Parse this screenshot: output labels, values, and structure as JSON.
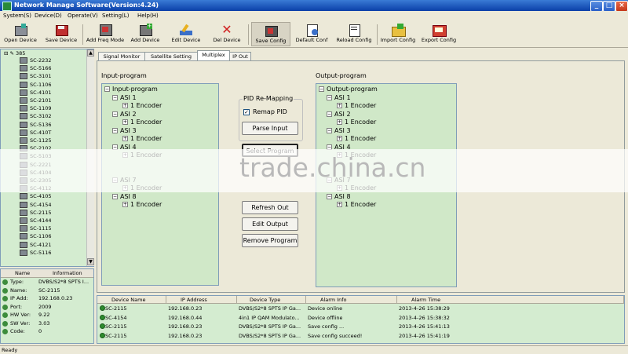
{
  "window": {
    "title": "Network Manage Software(Version:4.24)"
  },
  "menu": [
    "System(S)",
    "Device(D)",
    "Operate(V)",
    "Setting(L)",
    "Help(H)"
  ],
  "toolbar": [
    {
      "label": "Open Device",
      "icon": "open-device-icon"
    },
    {
      "label": "Save Device",
      "icon": "save-device-icon"
    },
    {
      "label": "Add Freq Mode",
      "icon": "add-freq-mode-icon"
    },
    {
      "label": "Add Device",
      "icon": "add-device-icon"
    },
    {
      "label": "Edit Device",
      "icon": "edit-device-icon"
    },
    {
      "label": "Del Device",
      "icon": "delete-device-icon"
    },
    {
      "label": "Save Config",
      "icon": "save-config-icon"
    },
    {
      "label": "Default Conf",
      "icon": "default-config-icon"
    },
    {
      "label": "Reload Config",
      "icon": "reload-config-icon"
    },
    {
      "label": "Import Config",
      "icon": "import-config-icon"
    },
    {
      "label": "Export Config",
      "icon": "export-config-icon"
    }
  ],
  "device_tree": {
    "root": "385",
    "items": [
      "SC-2232",
      "SC-5166",
      "SC-3101",
      "SC-1106",
      "SC-4101",
      "SC-2101",
      "SC-1109",
      "SC-3102",
      "SC-5136",
      "SC-410T",
      "SC-1125",
      "SC-2102",
      "SC-5103",
      "SC-2221",
      "SC-4104",
      "SC-2305",
      "SC-4112",
      "SC-4105",
      "SC-4154",
      "SC-2115",
      "SC-4144",
      "SC-1115",
      "SC-1106",
      "SC-4121",
      "SC-5116"
    ]
  },
  "info_panel": {
    "headers": [
      "Name",
      "Information"
    ],
    "rows": [
      {
        "key": "Type:",
        "value": "DVBS/S2*8 SPTS I..."
      },
      {
        "key": "Name:",
        "value": "SC-2115"
      },
      {
        "key": "IP Add:",
        "value": "192.168.0.23"
      },
      {
        "key": "Port:",
        "value": "2009"
      },
      {
        "key": "HW Ver:",
        "value": "9.22"
      },
      {
        "key": "SW Ver:",
        "value": "3.03"
      },
      {
        "key": "Code:",
        "value": "0"
      }
    ]
  },
  "tabs": [
    "Signal Monitor",
    "Satellite Setting",
    "Multiplex",
    "IP Out"
  ],
  "multiplex": {
    "input_label": "Input-program",
    "output_label": "Output-program",
    "input_tree": {
      "root": "Input-program",
      "asi": [
        "ASI 1",
        "ASI 2",
        "ASI 3",
        "ASI 4",
        "ASI 7",
        "ASI 8"
      ],
      "encoder": "1 Encoder"
    },
    "output_tree": {
      "root": "Output-program",
      "asi": [
        "ASI 1",
        "ASI 2",
        "ASI 3",
        "ASI 4",
        "ASI 7",
        "ASI 8"
      ],
      "encoder": "1 Encoder"
    },
    "pid_group": "PID Re-Mapping",
    "remap_pid": "Remap PID",
    "buttons": {
      "parse_input": "Parse Input",
      "select_program": "Select Program",
      "refresh_out": "Refresh Out",
      "edit_output": "Edit Output",
      "remove_program": "Remove Program"
    }
  },
  "alarm_list": {
    "columns": [
      "Device Name",
      "IP Address",
      "Device Type",
      "Alarm Info",
      "Alarm Time"
    ],
    "rows": [
      [
        "SC-2115",
        "192.168.0.23",
        "DVBS/S2*8 SPTS IP Ga...",
        "Device online",
        "2013-4-26 15:38:29"
      ],
      [
        "SC-4154",
        "192.168.0.44",
        "4in1 IP QAM Modulato...",
        "Device offline",
        "2013-4-26 15:38:32"
      ],
      [
        "SC-2115",
        "192.168.0.23",
        "DVBS/S2*8 SPTS IP Ga...",
        "Save config ...",
        "2013-4-26 15:41:13"
      ],
      [
        "SC-2115",
        "192.168.0.23",
        "DVBS/S2*8 SPTS IP Ga...",
        "Save config succeed!",
        "2013-4-26 15:41:19"
      ]
    ]
  },
  "status": "Ready",
  "watermark": "trade.china.cn",
  "colors": {
    "panel_green": "#d0e8c8",
    "title_blue": "#0a3fa8",
    "window_bg": "#ece9d8"
  }
}
